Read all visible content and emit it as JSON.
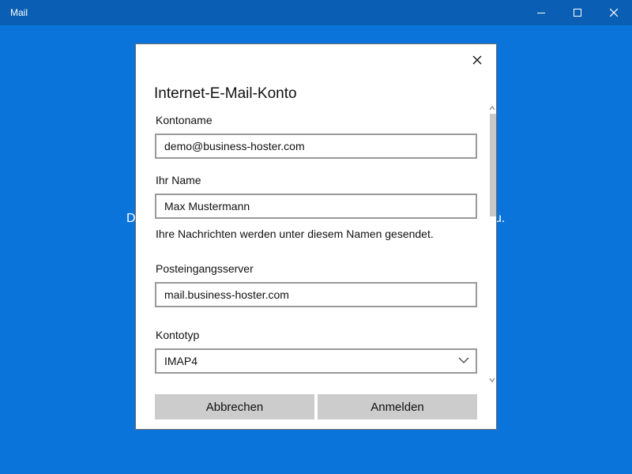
{
  "window": {
    "title": "Mail",
    "background_color": "#0a74da",
    "titlebar_color": "#0a5fb4"
  },
  "background": {
    "text_left_fragment": "D",
    "text_right_fragment": "u."
  },
  "dialog": {
    "title": "Internet-E-Mail-Konto",
    "fields": {
      "account_name": {
        "label": "Kontoname",
        "value": "demo@business-hoster.com"
      },
      "your_name": {
        "label": "Ihr Name",
        "value": "Max Mustermann",
        "hint": "Ihre Nachrichten werden unter diesem Namen gesendet."
      },
      "incoming_server": {
        "label": "Posteingangsserver",
        "value": "mail.business-hoster.com"
      },
      "account_type": {
        "label": "Kontotyp",
        "value": "IMAP4"
      }
    },
    "buttons": {
      "cancel": "Abbrechen",
      "sign_in": "Anmelden"
    }
  },
  "icons": {
    "minimize": "minimize-icon",
    "maximize": "maximize-icon",
    "close": "close-icon",
    "dialog_close": "close-icon",
    "dropdown": "chevron-down-icon"
  }
}
